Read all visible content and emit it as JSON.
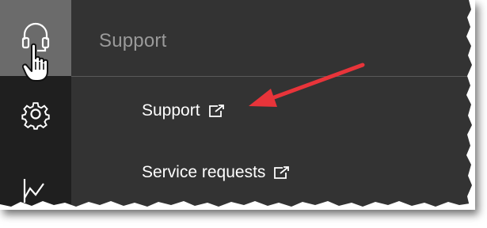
{
  "rail": {
    "items": [
      {
        "icon": "headset-icon",
        "active": true
      },
      {
        "icon": "gear-icon",
        "active": false
      },
      {
        "icon": "chart-icon",
        "active": false
      }
    ]
  },
  "panel": {
    "title": "Support",
    "items": [
      {
        "label": "Support",
        "icon": "external-link-icon"
      },
      {
        "label": "Service requests",
        "icon": "external-link-icon"
      }
    ]
  },
  "annotation": {
    "arrow_color": "#e8343a"
  },
  "colors": {
    "rail_bg": "#1f1f1f",
    "rail_active_bg": "#6b6b6b",
    "panel_bg": "#333333",
    "title_color": "#9a9a9a",
    "item_color": "#ffffff"
  }
}
